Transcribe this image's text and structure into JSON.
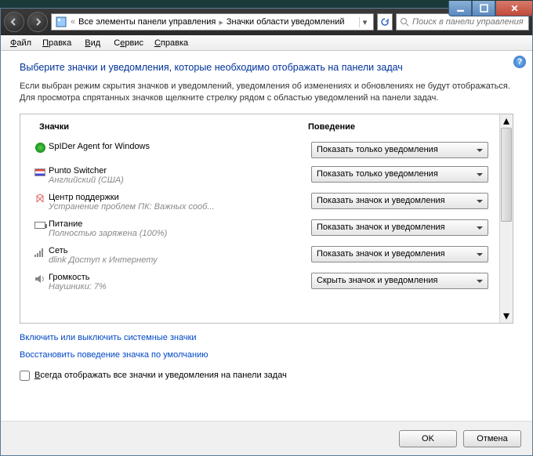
{
  "titlebar": {
    "minimize": "_",
    "maximize": "❐",
    "close": "✕"
  },
  "nav": {
    "breadcrumb_root": "Все элементы панели управления",
    "breadcrumb_current": "Значки области уведомлений",
    "search_placeholder": "Поиск в панели управления"
  },
  "menu": {
    "file": "Файл",
    "edit": "Правка",
    "view": "Вид",
    "service": "Сервис",
    "help": "Справка"
  },
  "heading": "Выберите значки и уведомления, которые необходимо отображать на панели задач",
  "description": "Если выбран режим скрытия значков и уведомлений, уведомления об изменениях и обновлениях не будут отображаться. Для просмотра спрятанных значков щелкните стрелку рядом с областью уведомлений на панели задач.",
  "columns": {
    "icons": "Значки",
    "behavior": "Поведение"
  },
  "behaviors": {
    "notify_only": "Показать только уведомления",
    "show_both": "Показать значок и уведомления",
    "hide_both": "Скрыть значок и уведомления"
  },
  "items": [
    {
      "title": "SpIDer Agent for Windows",
      "sub": "",
      "value": "notify_only",
      "icon": "shield"
    },
    {
      "title": "Punto Switcher",
      "sub": "Английский (США)",
      "value": "notify_only",
      "icon": "flag"
    },
    {
      "title": "Центр поддержки",
      "sub": "Устранение проблем ПК: Важных сооб...",
      "value": "show_both",
      "icon": "support"
    },
    {
      "title": "Питание",
      "sub": "Полностью заряжена (100%)",
      "value": "show_both",
      "icon": "battery"
    },
    {
      "title": "Сеть",
      "sub": "dlink Доступ к Интернету",
      "value": "show_both",
      "icon": "network"
    },
    {
      "title": "Громкость",
      "sub": "Наушники: 7%",
      "value": "hide_both",
      "icon": "volume"
    }
  ],
  "links": {
    "toggle_system": "Включить или выключить системные значки",
    "restore_default": "Восстановить поведение значка по умолчанию"
  },
  "checkbox_label": "Всегда отображать все значки и уведомления на панели задач",
  "buttons": {
    "ok": "OK",
    "cancel": "Отмена"
  }
}
